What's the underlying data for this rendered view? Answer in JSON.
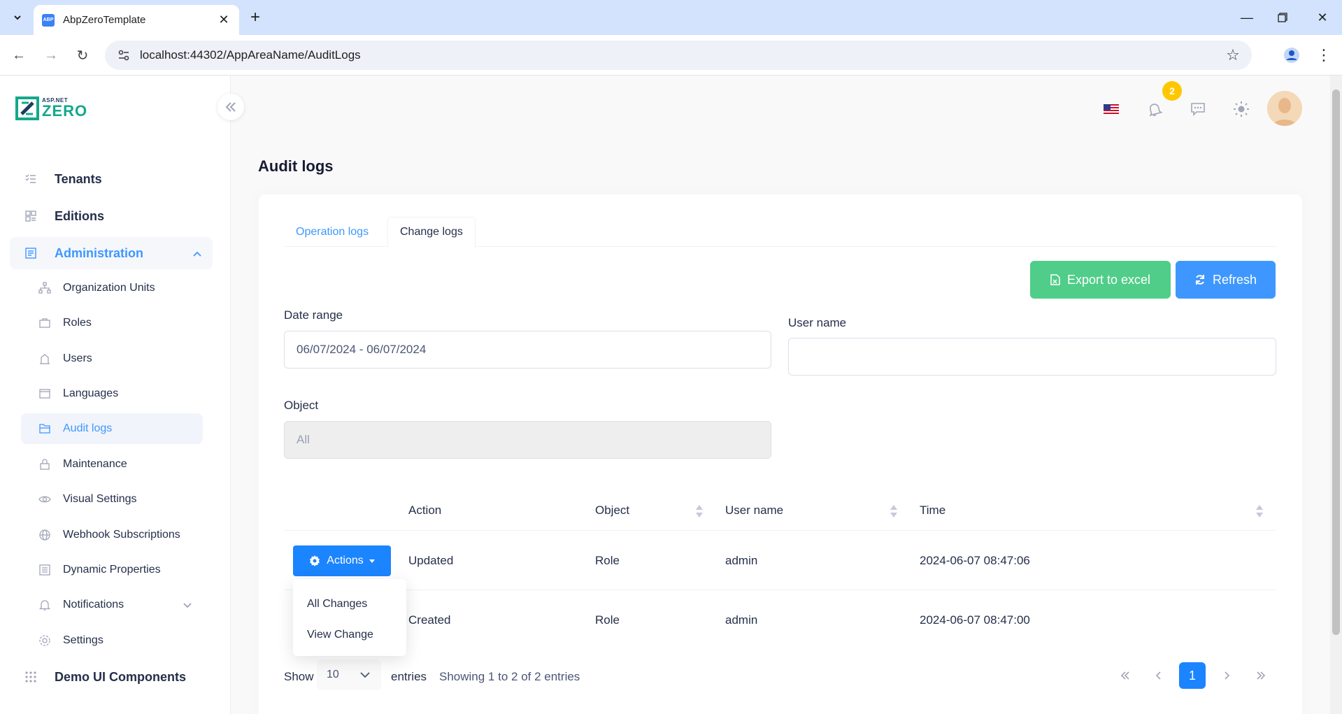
{
  "browser": {
    "tab_title": "AbpZeroTemplate",
    "favicon_text": "ABP",
    "url": "localhost:44302/AppAreaName/AuditLogs"
  },
  "logo": {
    "top_text": "ASP.NET",
    "main_text": "ZERO"
  },
  "sidebar": {
    "top_items": [
      {
        "label": "Tenants",
        "icon": "list-check-icon"
      },
      {
        "label": "Editions",
        "icon": "grid-icon"
      },
      {
        "label": "Administration",
        "icon": "admin-icon"
      },
      {
        "label": "Demo UI Components",
        "icon": "dots-grid-icon"
      }
    ],
    "admin_items": [
      {
        "label": "Organization Units",
        "icon": "org-chart-icon"
      },
      {
        "label": "Roles",
        "icon": "briefcase-icon"
      },
      {
        "label": "Users",
        "icon": "user-icon"
      },
      {
        "label": "Languages",
        "icon": "window-icon"
      },
      {
        "label": "Audit logs",
        "icon": "folder-icon"
      },
      {
        "label": "Maintenance",
        "icon": "lock-icon"
      },
      {
        "label": "Visual Settings",
        "icon": "eye-icon"
      },
      {
        "label": "Webhook Subscriptions",
        "icon": "globe-icon"
      },
      {
        "label": "Dynamic Properties",
        "icon": "document-icon"
      },
      {
        "label": "Notifications",
        "icon": "bell-icon"
      },
      {
        "label": "Settings",
        "icon": "gear-icon"
      }
    ]
  },
  "header": {
    "notification_count": "2"
  },
  "page": {
    "title": "Audit logs"
  },
  "tabs": {
    "operation": "Operation logs",
    "change": "Change logs"
  },
  "buttons": {
    "export": "Export to excel",
    "refresh": "Refresh"
  },
  "filters": {
    "date_range_label": "Date range",
    "date_range_value": "06/07/2024 - 06/07/2024",
    "user_name_label": "User name",
    "user_name_value": "",
    "object_label": "Object",
    "object_value": "All"
  },
  "table": {
    "headers": {
      "action": "Action",
      "object": "Object",
      "user_name": "User name",
      "time": "Time"
    },
    "rows": [
      {
        "action": "Updated",
        "object": "Role",
        "user_name": "admin",
        "time": "2024-06-07 08:47:06"
      },
      {
        "action": "Created",
        "object": "Role",
        "user_name": "admin",
        "time": "2024-06-07 08:47:00"
      }
    ],
    "actions_label": "Actions",
    "dropdown": [
      "All Changes",
      "View Change"
    ]
  },
  "footer": {
    "show_label": "Show",
    "page_size": "10",
    "entries_label": "entries",
    "showing_text": "Showing 1 to 2 of 2 entries",
    "current_page": "1"
  },
  "colors": {
    "primary": "#1b84ff",
    "success": "#50cd89",
    "accent": "#3e97ff",
    "badge": "#ffc700"
  }
}
